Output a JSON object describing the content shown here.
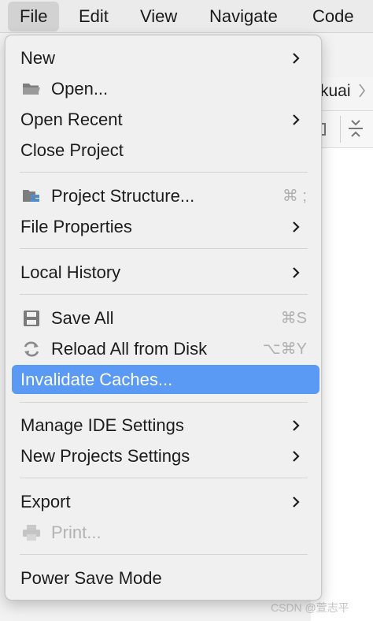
{
  "menubar": {
    "items": [
      {
        "label": "File",
        "active": true
      },
      {
        "label": "Edit"
      },
      {
        "label": "View"
      },
      {
        "label": "Navigate"
      },
      {
        "label": "Code"
      }
    ]
  },
  "background": {
    "nav_fragment": "kuai",
    "watermark": "CSDN @萱志平"
  },
  "file_menu": {
    "items": [
      {
        "label": "New",
        "has_submenu": true
      },
      {
        "label": "Open...",
        "icon": "folder-icon"
      },
      {
        "label": "Open Recent",
        "has_submenu": true
      },
      {
        "label": "Close Project"
      },
      {
        "label": "Project Structure...",
        "icon": "project-structure-icon",
        "shortcut": "⌘ ;"
      },
      {
        "label": "File Properties",
        "has_submenu": true
      },
      {
        "label": "Local History",
        "has_submenu": true
      },
      {
        "label": "Save All",
        "icon": "save-icon",
        "shortcut": "⌘S"
      },
      {
        "label": "Reload All from Disk",
        "icon": "reload-icon",
        "shortcut": "⌥⌘Y"
      },
      {
        "label": "Invalidate Caches...",
        "highlighted": true
      },
      {
        "label": "Manage IDE Settings",
        "has_submenu": true
      },
      {
        "label": "New Projects Settings",
        "has_submenu": true
      },
      {
        "label": "Export",
        "has_submenu": true
      },
      {
        "label": "Print...",
        "icon": "printer-icon",
        "disabled": true
      },
      {
        "label": "Power Save Mode"
      }
    ]
  },
  "colors": {
    "highlight": "#5b9af4",
    "menu_background": "#f0f0f0",
    "shortcut_text": "#b0b0b0",
    "disabled_text": "#b3b3b3"
  }
}
